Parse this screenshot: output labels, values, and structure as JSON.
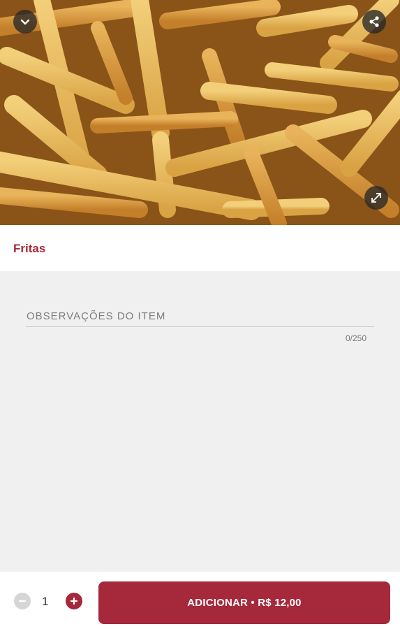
{
  "product": {
    "name": "Fritas"
  },
  "notes": {
    "placeholder": "OBSERVAÇÕES DO ITEM",
    "counter": "0/250"
  },
  "footer": {
    "quantity": "1",
    "add_label": "ADICIONAR • R$ 12,00"
  },
  "icons": {
    "collapse": "chevron-down-icon",
    "share": "share-icon",
    "expand": "expand-icon",
    "minus": "minus-circle-icon",
    "plus": "plus-circle-icon"
  },
  "colors": {
    "accent": "#a6283b",
    "disabled": "#d6d6d6"
  }
}
